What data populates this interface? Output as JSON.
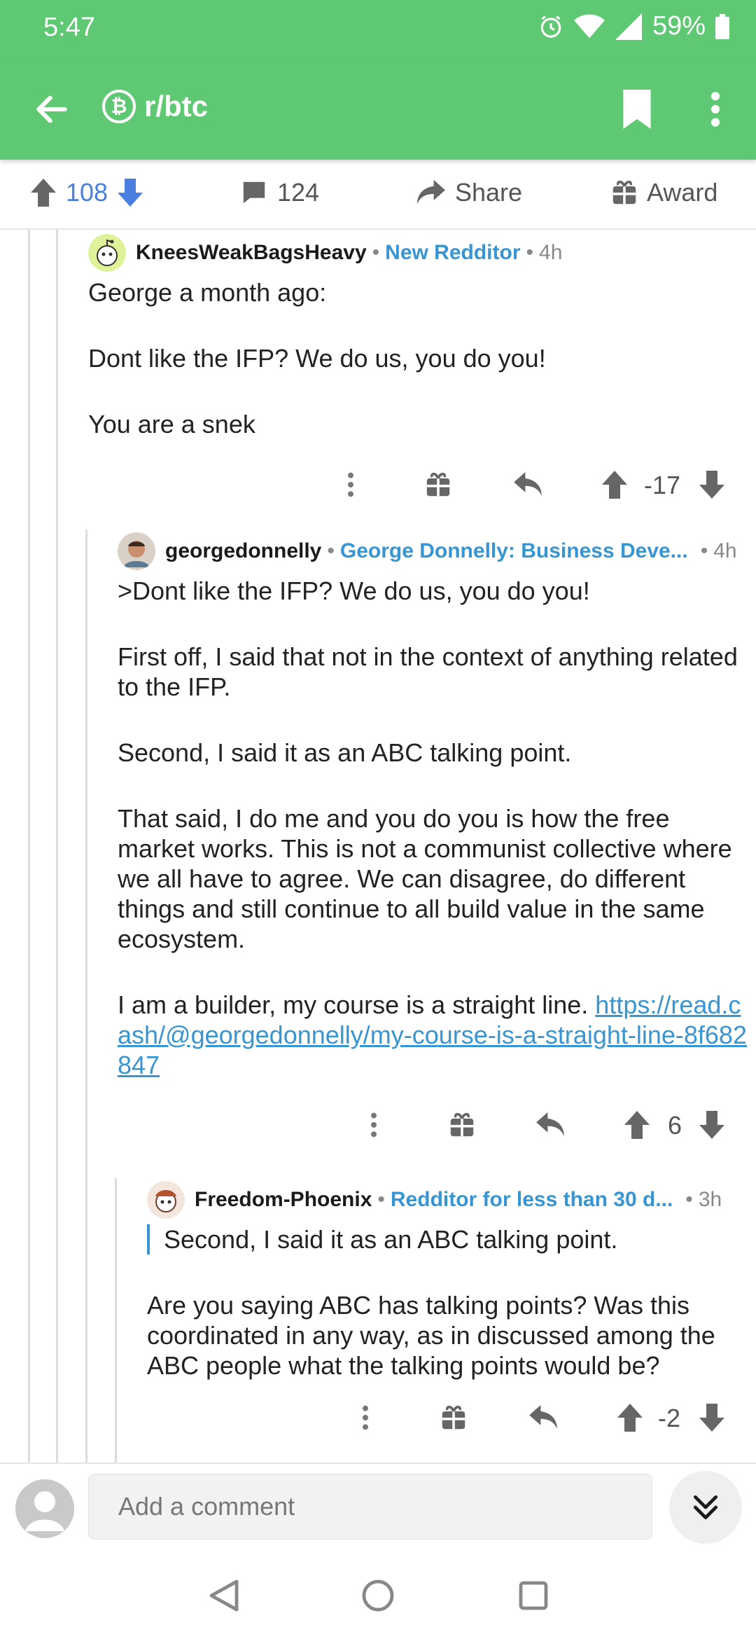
{
  "status_bar": {
    "time": "5:47",
    "battery": "59%"
  },
  "app_bar": {
    "subreddit": "r/btc",
    "subreddit_icon": "₿"
  },
  "post_actions": {
    "upvotes": "108",
    "comments": "124",
    "share": "Share",
    "award": "Award"
  },
  "comments": [
    {
      "user": "KneesWeakBagsHeavy",
      "flair": "New Redditor",
      "age": "4h",
      "paragraphs": [
        "George a month ago:",
        "Dont like the IFP? We do us, you do you!",
        "You are a snek"
      ],
      "score": "-17"
    },
    {
      "user": "georgedonnelly",
      "flair": "George Donnelly: Business Deve...",
      "age": "4h",
      "paragraphs": [
        ">Dont like the IFP? We do us, you do you!",
        "First off, I said that not in the context of anything related to the IFP.",
        "Second, I said it as an ABC talking point.",
        "That said, I do me and you do you is how the free market works. This is not a communist collective where we all have to agree. We can disagree, do different things and still continue to all build value in the same ecosystem."
      ],
      "last_paragraph_text": "I am a builder, my course is a straight line. ",
      "link": "https://read.cash/@georgedonnelly/my-course-is-a-straight-line-8f682847",
      "score": "6"
    },
    {
      "user": "Freedom-Phoenix",
      "flair": "Redditor for less than 30 d...",
      "age": "3h",
      "quote": "Second, I said it as an ABC talking point.",
      "paragraphs": [
        "Are you saying ABC has talking points? Was this coordinated in any way, as in discussed among the ABC people what the talking points would be?"
      ],
      "score": "-2"
    }
  ],
  "composer": {
    "placeholder": "Add a comment"
  },
  "colors": {
    "brand_green": "#5ec972",
    "link_blue": "#3895d3",
    "upvote_blue": "#4a7ee0"
  }
}
